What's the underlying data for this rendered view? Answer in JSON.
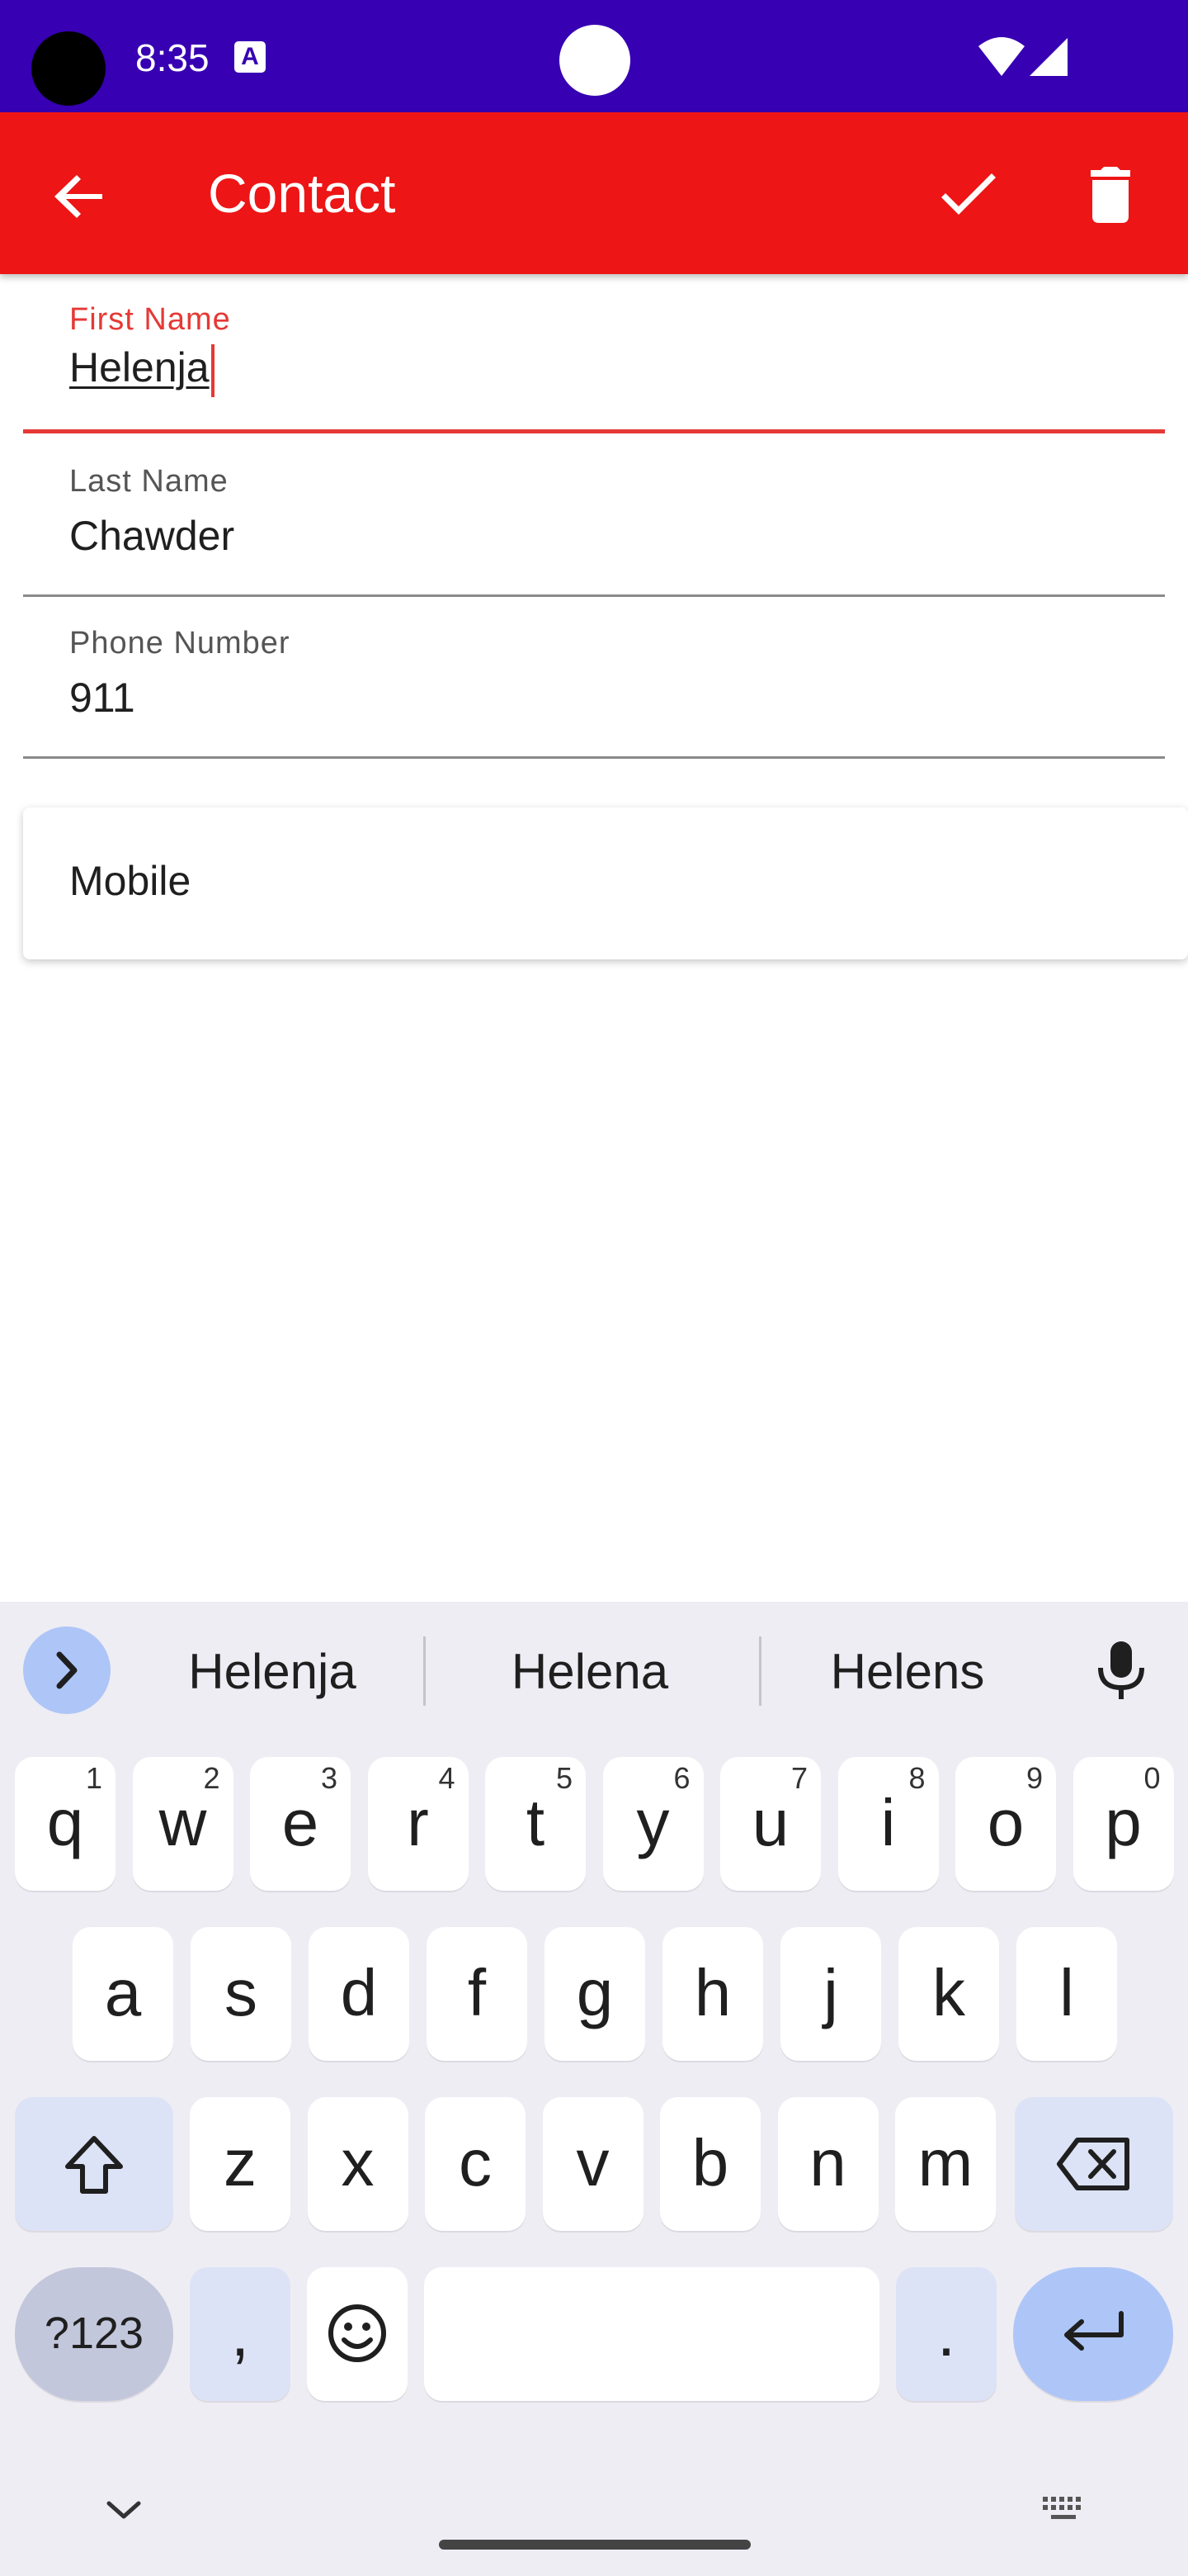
{
  "status_bar": {
    "time": "8:35",
    "a_icon_letter": "A"
  },
  "app_bar": {
    "title": "Contact"
  },
  "fields": [
    {
      "label": "First Name",
      "value": "Helenja"
    },
    {
      "label": "Last Name",
      "value": "Chawder"
    },
    {
      "label": "Phone Number",
      "value": "911"
    }
  ],
  "phone_type": {
    "value": "Mobile"
  },
  "keyboard": {
    "suggestions": [
      "Helenja",
      "Helena",
      "Helens"
    ],
    "row1": [
      {
        "k": "q",
        "n": "1"
      },
      {
        "k": "w",
        "n": "2"
      },
      {
        "k": "e",
        "n": "3"
      },
      {
        "k": "r",
        "n": "4"
      },
      {
        "k": "t",
        "n": "5"
      },
      {
        "k": "y",
        "n": "6"
      },
      {
        "k": "u",
        "n": "7"
      },
      {
        "k": "i",
        "n": "8"
      },
      {
        "k": "o",
        "n": "9"
      },
      {
        "k": "p",
        "n": "0"
      }
    ],
    "row2": [
      "a",
      "s",
      "d",
      "f",
      "g",
      "h",
      "j",
      "k",
      "l"
    ],
    "row3": [
      "z",
      "x",
      "c",
      "v",
      "b",
      "n",
      "m"
    ],
    "symbols_label": "?123",
    "comma": ",",
    "period": "."
  },
  "colors": {
    "status_bar": "#3700b3",
    "app_bar": "#ed1515",
    "accent": "#e53935",
    "keyboard_bg": "#efedf4"
  }
}
